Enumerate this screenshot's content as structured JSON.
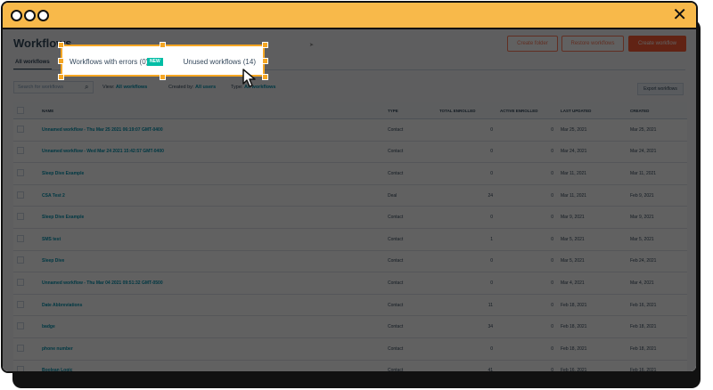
{
  "header": {
    "title": "Workflows",
    "buttons": [
      "Create folder",
      "Restore workflows",
      "Create workflow"
    ]
  },
  "tabs": [
    "All workflows"
  ],
  "filters": {
    "search_placeholder": "Search for workflows",
    "view_label": "View:",
    "view_value": "All workflows",
    "created_label": "Created by:",
    "created_value": "All users",
    "type_label": "Type:",
    "type_value": "All workflows",
    "export_label": "Export workflows"
  },
  "table": {
    "columns": [
      "NAME",
      "TYPE",
      "TOTAL ENROLLED",
      "ACTIVE ENROLLED",
      "LAST UPDATED",
      "CREATED"
    ],
    "rows": [
      {
        "name": "Unnamed workflow - Thu Mar 25 2021 06:19:07 GMT-0400",
        "type": "Contact",
        "total": "0",
        "active": "0",
        "updated": "Mar 25, 2021",
        "created": "Mar 25, 2021"
      },
      {
        "name": "Unnamed workflow - Wed Mar 24 2021 15:42:57 GMT-0400",
        "type": "Contact",
        "total": "0",
        "active": "0",
        "updated": "Mar 24, 2021",
        "created": "Mar 24, 2021"
      },
      {
        "name": "Sleep Dive Example",
        "type": "Contact",
        "total": "0",
        "active": "0",
        "updated": "Mar 11, 2021",
        "created": "Mar 11, 2021"
      },
      {
        "name": "CSA Test 2",
        "type": "Deal",
        "total": "24",
        "active": "0",
        "updated": "Mar 11, 2021",
        "created": "Feb 9, 2021"
      },
      {
        "name": "Sleep Dive Example",
        "type": "Contact",
        "total": "0",
        "active": "0",
        "updated": "Mar 9, 2021",
        "created": "Mar 9, 2021"
      },
      {
        "name": "SMS test",
        "type": "Contact",
        "total": "1",
        "active": "0",
        "updated": "Mar 5, 2021",
        "created": "Mar 5, 2021"
      },
      {
        "name": "Sleep Dive",
        "type": "Contact",
        "total": "0",
        "active": "0",
        "updated": "Mar 5, 2021",
        "created": "Feb 24, 2021"
      },
      {
        "name": "Unnamed workflow - Thu Mar 04 2021 09:51:32 GMT-0500",
        "type": "Contact",
        "total": "0",
        "active": "0",
        "updated": "Mar 4, 2021",
        "created": "Mar 4, 2021"
      },
      {
        "name": "Date Abbreviations",
        "type": "Contact",
        "total": "11",
        "active": "0",
        "updated": "Feb 18, 2021",
        "created": "Feb 16, 2021"
      },
      {
        "name": "badge",
        "type": "Contact",
        "total": "34",
        "active": "0",
        "updated": "Feb 18, 2021",
        "created": "Feb 18, 2021"
      },
      {
        "name": "phone number",
        "type": "Contact",
        "total": "0",
        "active": "0",
        "updated": "Feb 18, 2021",
        "created": "Feb 18, 2021"
      },
      {
        "name": "Boolean Logic",
        "type": "Contact",
        "total": "41",
        "active": "0",
        "updated": "Feb 16, 2021",
        "created": "Feb 16, 2021"
      }
    ]
  },
  "popup": {
    "errors_label": "Workflows with errors (0)",
    "badge": "NEW",
    "unused_label": "Unused workflows (14)"
  },
  "colors": {
    "titlebar": "#f8b94a",
    "highlight": "#f5a623",
    "badge": "#00bda5",
    "accent": "#ff5c35"
  }
}
